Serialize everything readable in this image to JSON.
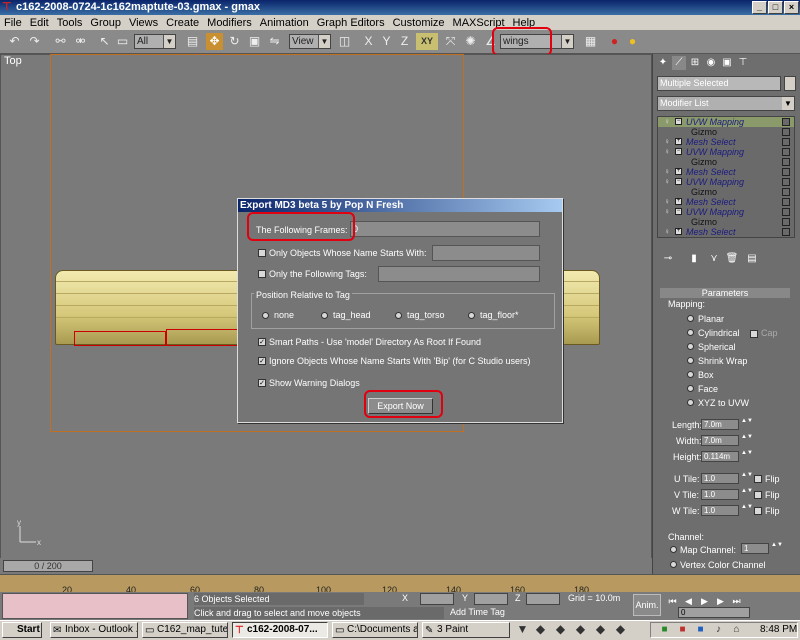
{
  "window": {
    "title": "c162-2008-0724-1c162maptute-03.gmax - gmax"
  },
  "menu": [
    "File",
    "Edit",
    "Tools",
    "Group",
    "Views",
    "Create",
    "Modifiers",
    "Animation",
    "Graph Editors",
    "Customize",
    "MAXScript",
    "Help"
  ],
  "toolbar": {
    "filter": "All",
    "coord_system": "View",
    "axis_xy": "XY",
    "named_selection": "wings"
  },
  "viewport": {
    "label": "Top"
  },
  "dialog": {
    "title": "Export MD3 beta 5 by Pop N Fresh",
    "frames_label": "The Following Frames:",
    "frames_value": "0",
    "only_objects_label": "Only Objects Whose Name Starts With:",
    "only_tags_label": "Only the Following Tags:",
    "group_label": "Position Relative to Tag",
    "radios": [
      "none",
      "tag_head",
      "tag_torso",
      "tag_floor*"
    ],
    "smart_paths": "Smart Paths - Use 'model' Directory As Root If Found",
    "ignore_bip": "Ignore Objects Whose Name Starts With 'Bip' (for C Studio users)",
    "show_warnings": "Show Warning Dialogs",
    "export_button": "Export Now"
  },
  "command_panel": {
    "selection_name": "Multiple Selected",
    "modifier_list": "Modifier List",
    "stack": [
      {
        "name": "UVW Mapping",
        "type": "mod"
      },
      {
        "name": "Gizmo",
        "type": "sub"
      },
      {
        "name": "Mesh Select",
        "type": "mod"
      },
      {
        "name": "UVW Mapping",
        "type": "mod"
      },
      {
        "name": "Gizmo",
        "type": "sub"
      },
      {
        "name": "Mesh Select",
        "type": "mod"
      },
      {
        "name": "UVW Mapping",
        "type": "mod"
      },
      {
        "name": "Gizmo",
        "type": "sub"
      },
      {
        "name": "Mesh Select",
        "type": "mod"
      },
      {
        "name": "UVW Mapping",
        "type": "mod"
      },
      {
        "name": "Gizmo",
        "type": "sub"
      },
      {
        "name": "Mesh Select",
        "type": "mod"
      }
    ],
    "params_title": "Parameters",
    "mapping_label": "Mapping:",
    "mapping_options": [
      "Planar",
      "Cylindrical",
      "Spherical",
      "Shrink Wrap",
      "Box",
      "Face",
      "XYZ to UVW"
    ],
    "cap_label": "Cap",
    "length_label": "Length:",
    "length_value": "7.0m",
    "width_label": "Width:",
    "width_value": "7.0m",
    "height_label": "Height:",
    "height_value": "0.114m",
    "utile_label": "U Tile:",
    "utile_value": "1.0",
    "vtile_label": "V Tile:",
    "vtile_value": "1.0",
    "wtile_label": "W Tile:",
    "wtile_value": "1.0",
    "flip_label": "Flip",
    "channel_label": "Channel:",
    "map_channel_label": "Map Channel:",
    "map_channel_value": "1",
    "vertex_color_label": "Vertex Color Channel"
  },
  "timeline": {
    "slider": "0 / 200",
    "ticks": [
      "20",
      "40",
      "60",
      "80",
      "100",
      "120",
      "140",
      "160",
      "180"
    ]
  },
  "status": {
    "selected": "6 Objects Selected",
    "hint": "Click and drag to select and move objects",
    "x_label": "X",
    "y_label": "Y",
    "z_label": "Z",
    "grid": "Grid = 10.0m",
    "add_time_tag": "Add Time Tag",
    "anim": "Anim.",
    "frame": "0"
  },
  "taskbar": {
    "start": "Start",
    "tasks": [
      "Inbox - Outlook ...",
      "C162_map_tute",
      "c162-2008-07...",
      "C:\\Documents a...",
      "3 Paint"
    ],
    "clock": "8:48 PM"
  }
}
